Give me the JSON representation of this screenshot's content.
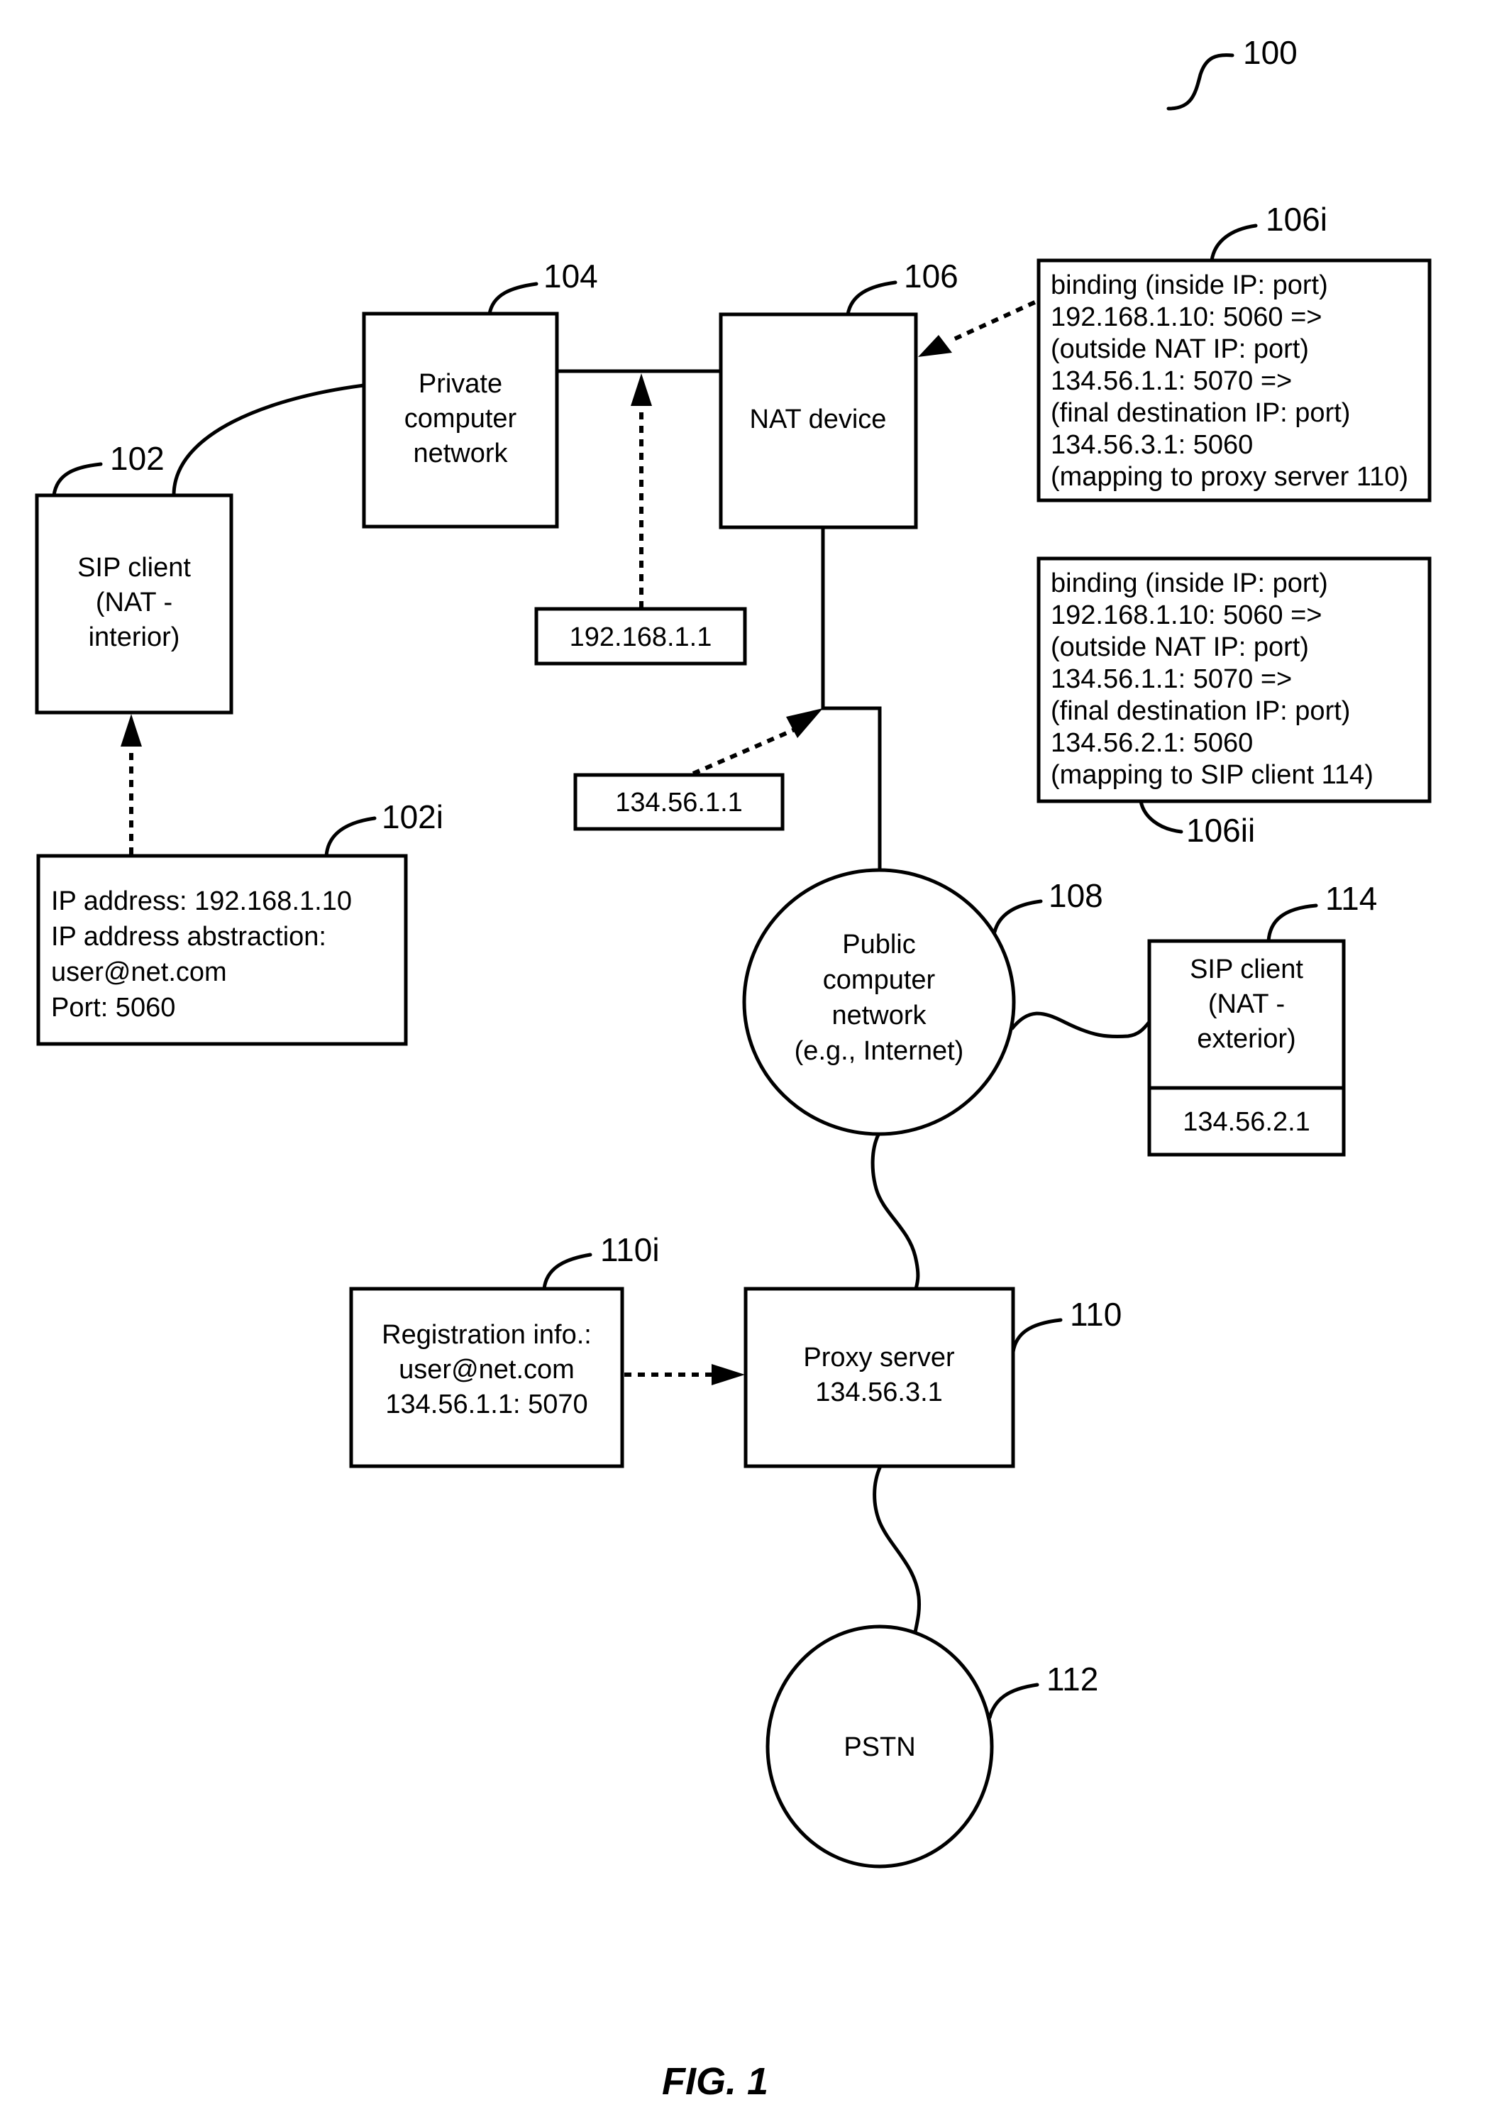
{
  "figure": {
    "caption": "FIG. 1",
    "system_ref": "100"
  },
  "nodes": {
    "sip_client_interior": {
      "ref": "102",
      "lines": [
        "SIP client",
        "(NAT -",
        "interior)"
      ]
    },
    "sip_client_interior_info": {
      "ref": "102i",
      "lines": [
        "IP address: 192.168.1.10",
        "IP address abstraction:",
        "user@net.com",
        "Port: 5060"
      ]
    },
    "private_network": {
      "ref": "104",
      "lines": [
        "Private",
        "computer",
        "network"
      ]
    },
    "private_ip": {
      "label": "192.168.1.1"
    },
    "nat_device": {
      "ref": "106",
      "lines": [
        "NAT device"
      ]
    },
    "public_ip": {
      "label": "134.56.1.1"
    },
    "binding_proxy": {
      "ref": "106i",
      "lines": [
        "binding (inside IP: port)",
        "192.168.1.10: 5060 =>",
        "(outside NAT IP: port)",
        "134.56.1.1: 5070 =>",
        "(final destination IP: port)",
        "134.56.3.1: 5060",
        "(mapping to proxy server 110)"
      ]
    },
    "binding_client": {
      "ref": "106ii",
      "lines": [
        "binding (inside IP: port)",
        "192.168.1.10: 5060 =>",
        "(outside NAT IP: port)",
        "134.56.1.1: 5070 =>",
        "(final destination IP: port)",
        "134.56.2.1: 5060",
        "(mapping to SIP client 114)"
      ]
    },
    "public_network": {
      "ref": "108",
      "lines": [
        "Public",
        "computer",
        "network",
        "(e.g., Internet)"
      ]
    },
    "sip_client_exterior": {
      "ref": "114",
      "lines": [
        "SIP client",
        "(NAT -",
        "exterior)"
      ],
      "ip": "134.56.2.1"
    },
    "registration_info": {
      "ref": "110i",
      "lines": [
        "Registration info.:",
        "user@net.com",
        "134.56.1.1: 5070"
      ]
    },
    "proxy_server": {
      "ref": "110",
      "lines": [
        "Proxy server",
        "134.56.3.1"
      ]
    },
    "pstn": {
      "ref": "112",
      "lines": [
        "PSTN"
      ]
    }
  }
}
